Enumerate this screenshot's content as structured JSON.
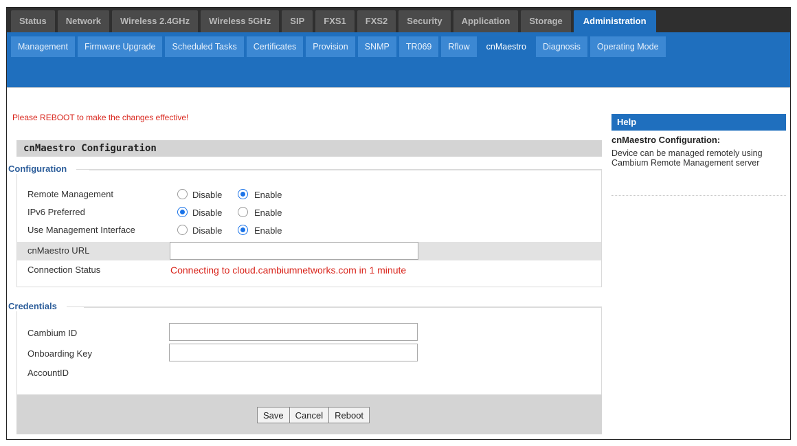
{
  "top_tabs": [
    "Status",
    "Network",
    "Wireless 2.4GHz",
    "Wireless 5GHz",
    "SIP",
    "FXS1",
    "FXS2",
    "Security",
    "Application",
    "Storage",
    "Administration"
  ],
  "sub_tabs": [
    "Management",
    "Firmware Upgrade",
    "Scheduled Tasks",
    "Certificates",
    "Provision",
    "SNMP",
    "TR069",
    "Rflow",
    "cnMaestro",
    "Diagnosis",
    "Operating Mode"
  ],
  "active_top_tab": "Administration",
  "active_sub_tab": "cnMaestro",
  "reboot_message": "Please REBOOT to make the changes effective!",
  "section_title": "cnMaestro Configuration",
  "configuration": {
    "legend": "Configuration",
    "remote_management": {
      "label": "Remote Management",
      "selected": "Enable"
    },
    "ipv6_preferred": {
      "label": "IPv6 Preferred",
      "selected": "Disable"
    },
    "use_management_interface": {
      "label": "Use Management Interface",
      "selected": "Enable"
    },
    "option_disable": "Disable",
    "option_enable": "Enable",
    "cnmaestro_url": {
      "label": "cnMaestro URL",
      "value": ""
    },
    "connection_status": {
      "label": "Connection Status",
      "value": "Connecting to cloud.cambiumnetworks.com in 1 minute"
    }
  },
  "credentials": {
    "legend": "Credentials",
    "cambium_id": {
      "label": "Cambium ID",
      "value": ""
    },
    "onboarding_key": {
      "label": "Onboarding Key",
      "value": ""
    },
    "account_id": {
      "label": "AccountID"
    }
  },
  "buttons": {
    "save": "Save",
    "cancel": "Cancel",
    "reboot": "Reboot"
  },
  "help": {
    "header": "Help",
    "title": "cnMaestro Configuration:",
    "body": "Device can be managed remotely using Cambium Remote Management server"
  },
  "colors": {
    "tab_blue": "#1f6fbe",
    "status_red": "#d9241b",
    "highlight_green": "#2fc22f"
  }
}
